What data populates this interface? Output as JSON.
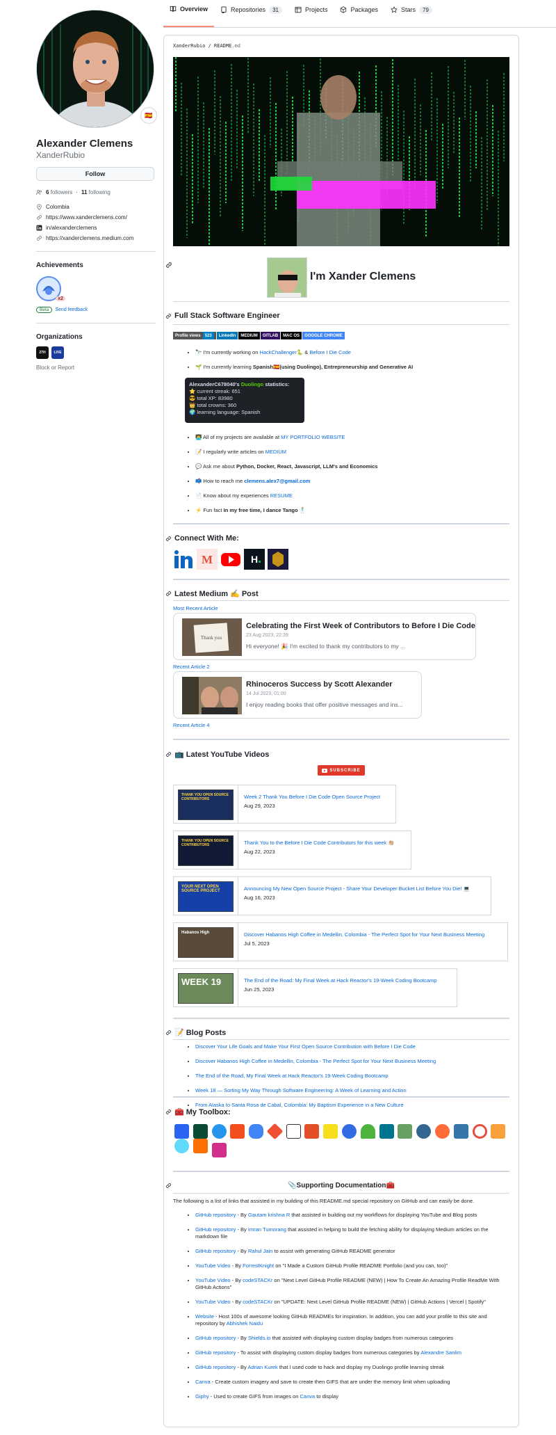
{
  "nav": {
    "tabs": [
      {
        "label": "Overview",
        "count": ""
      },
      {
        "label": "Repositories",
        "count": "31"
      },
      {
        "label": "Projects",
        "count": ""
      },
      {
        "label": "Packages",
        "count": ""
      },
      {
        "label": "Stars",
        "count": "79"
      }
    ]
  },
  "profile": {
    "full_name": "Alexander Clemens",
    "login": "XanderRubio",
    "flag": "🇪🇸",
    "follow_label": "Follow",
    "followers": "6",
    "followers_label": "followers",
    "following": "11",
    "following_label": "following",
    "location": "Colombia",
    "website": "https://www.xanderclemens.com/",
    "linkedin": "in/alexanderclemens",
    "medium": "https://xanderclemens.medium.com",
    "achievements_heading": "Achievements",
    "achievement_count": "x2",
    "beta_label": "Beta",
    "feedback_label": "Send feedback",
    "organizations_heading": "Organizations",
    "org1": "27H",
    "org2": "LIVE",
    "block_label": "Block or Report"
  },
  "readme": {
    "path_user": "XanderRubio",
    "path_sep": " / ",
    "path_file": "README",
    "path_ext": ".md",
    "intro_title": "I'm Xander Clemens",
    "sec_role": "Full Stack Software Engineer",
    "badges": {
      "views_label": "Profile views",
      "views_value": "523",
      "linkedin": "LinkedIn",
      "medium": "MEDIUM",
      "gitlab": "GITLAB",
      "macos": "MAC OS",
      "chrome": "GOOGLE CHROME"
    },
    "about": [
      {
        "pre": "🔭 I'm currently working on ",
        "link1": "HackChallenger",
        "mid": "🐍 & ",
        "link2": "Before I Die Code",
        "post": ""
      },
      {
        "pre": "🌱 I'm currently learning ",
        "bold": "Spanish🇪🇸(using Duolingo), Entrepreneurship and Generative AI"
      }
    ],
    "duolingo": {
      "title_user": "AlexanderC678040's",
      "title_app": "Duolingo",
      "title_suffix": "statistics:",
      "streak": "⭐ current streak: 651",
      "xp": "😎 total XP: 83980",
      "crowns": "👑 total crowns: 360",
      "language": "🌍 learning language: Spanish"
    },
    "about2": [
      {
        "pre": "👨‍💻 All of my projects are available at ",
        "link": "MY PORTFOLIO WEBSITE"
      },
      {
        "pre": "📝 I regularly write articles on ",
        "link": "MEDIUM"
      },
      {
        "pre": "💬 Ask me about ",
        "bold": "Python, Docker, React, Javascript, LLM's and Economics"
      },
      {
        "pre": "📫 How to reach me ",
        "bold_link": "clemens.alex7@gmail.com"
      },
      {
        "pre": "📄 Know about my experiences ",
        "link": "RESUME"
      },
      {
        "pre": "⚡ Fun fact ",
        "bold": "In my free time, I dance Tango 🕺"
      }
    ],
    "sec_connect": "Connect With Me:",
    "connect_icons": [
      "linkedin-icon",
      "medium-icon",
      "youtube-icon",
      "hackerrank-icon",
      "coding-icon"
    ],
    "sec_medium": "Latest Medium ✍️ Post",
    "medium_alt1": "Most Recent Article",
    "medium_cards": [
      {
        "title": "Celebrating the First Week of Contributors to Before I Die Code",
        "date": "23 Aug 2023, 22:39",
        "desc": "Hi everyone! 🎉 I'm excited to thank my contributors to my ..."
      },
      {
        "title": "Rhinoceros Success by Scott Alexander",
        "date": "14 Jul 2023, 01:00",
        "desc": "I enjoy reading books that offer positive messages and ins..."
      }
    ],
    "medium_alt2": "Recent Article 2",
    "medium_alt4": "Recent Article 4",
    "sec_youtube": "📺 Latest YouTube Videos",
    "subscribe": "SUBSCRIBE",
    "videos": [
      {
        "title": "Week 2 Thank You Before I Die Code Open Source Project",
        "date": "Aug 29, 2023",
        "thumb": "THANK YOU OPEN SOURCE CONTRIBUTORS"
      },
      {
        "title": "Thank You to the Before I Die Code Contributors for this week 👏🏼",
        "date": "Aug 22, 2023",
        "thumb": "THANK YOU OPEN SOURCE CONTRIBUTORS"
      },
      {
        "title": "Announcing My New Open Source Project - Share Your Developer Bucket List Before You Die! 💻",
        "date": "Aug 16, 2023",
        "thumb": "YOUR NEXT OPEN SOURCE PROJECT"
      },
      {
        "title": "Discover Habanos High Coffee in Medellin, Colombia - The Perfect Spot for Your Next Business Meeting",
        "date": "Jul 5, 2023",
        "thumb": "Habanos High"
      },
      {
        "title": "The End of the Road: My Final Week at Hack Reactor's 19-Week Coding Bootcamp",
        "date": "Jun 25, 2023",
        "thumb": "WEEK 19"
      }
    ],
    "sec_blog": "📝 Blog Posts",
    "blog": [
      "Discover Your Life Goals and Make Your First Open Source Contribution with Before I Die Code",
      "Discover Habanos High Coffee in Medellin, Colombia - The Perfect Spot for Your Next Business Meeting",
      "The End of the Road, My Final Week at Hack Reactor's 19-Week Coding Bootcamp",
      "Week 18 — Sorting My Way Through Software Engineering: A Week of Learning and Action",
      "From Alaska to Santa Rosa de Cabal, Colombia: My Baptism Experience in a New Culture"
    ],
    "sec_toolbox": "🧰 My Toolbox:",
    "sec_docs": "📎Supporting Documentation🧰",
    "docs_intro": "The following is a list of links that assisted in my building of this README.md special repository on GitHub and can easily be done.",
    "docs": [
      {
        "l1": "GitHub repository",
        "t1": " - By ",
        "l2": "Gautam krishna R",
        "t2": " that assisted in building out my workflows for displaying YouTube and Blog posts"
      },
      {
        "l1": "GitHub repository",
        "t1": " - By ",
        "l2": "Imran Tumorang",
        "t2": " that assisted in helping to build the fetching ability for displaying Medium articles on the markdown file"
      },
      {
        "l1": "GitHub repository",
        "t1": " - By ",
        "l2": "Rahul Jain",
        "t2": " to assist with generating GitHub README generator"
      },
      {
        "l1": "YouTube Video",
        "t1": " - By ",
        "l2": "ForrestKnight",
        "t2": " on \"I Made a Custom GitHub Profile README Portfolio (and you can, too)\""
      },
      {
        "l1": "YouTube Video",
        "t1": " - By ",
        "l2": "codeSTACKr",
        "t2": " on \"Next Level GitHub Profile README (NEW) | How To Create An Amazing Profile ReadMe With GitHub Actions\""
      },
      {
        "l1": "YouTube Video",
        "t1": " - By ",
        "l2": "codeSTACKr",
        "t2": " on \"UPDATE: Next Level GitHub Profile README (NEW) | GitHub Actions | Vercel | Spotify\""
      },
      {
        "l1": "Website",
        "t1": " - Host 100s of awesome looking GitHub READMEs for inspiration. In addition, you can add your profile to this site and repository by ",
        "l2": "Abhishek Naidu",
        "t2": ""
      },
      {
        "l1": "GitHub repository",
        "t1": " - By ",
        "l2": "Shields.io",
        "t2": " that assisted with displaying custom display badges from numerous categories"
      },
      {
        "l1": "GitHub repository",
        "t1": " - To assist with displaying custom display badges from numerous categories by ",
        "l2": "Alexandre Sanlim",
        "t2": ""
      },
      {
        "l1": "GitHub repository",
        "t1": " - By ",
        "l2": "Adrian Kurek",
        "t2": " that I used code to hack and display my Duolingo profile learning streak"
      },
      {
        "l1": "Canva",
        "t1": " - Create custom imagery and save to create then GIFS that are under the memory limit when uploading",
        "l2": "",
        "t2": ""
      },
      {
        "l1": "Giphy",
        "t1": " - Used to create GIFS from images on ",
        "l2": "Canva",
        "t2": " to display"
      }
    ]
  },
  "colors": {
    "accent": "#0969da",
    "tab_underline": "#fd8c73",
    "border": "#d0d7de",
    "muted": "#656d76"
  }
}
